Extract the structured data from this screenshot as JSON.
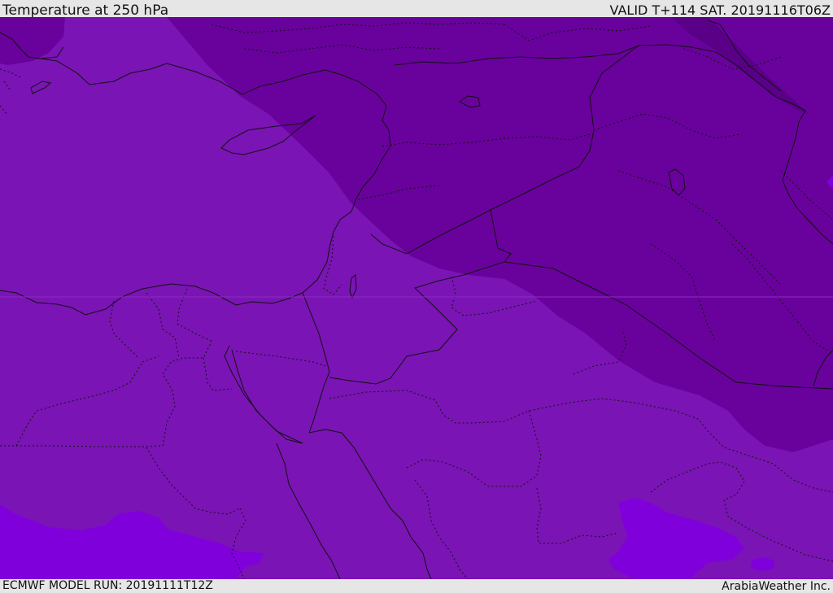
{
  "header": {
    "title": "Temperature at 250 hPa",
    "valid": "VALID T+114 SAT. 20191116T06Z"
  },
  "footer": {
    "model_run": "ECMWF MODEL RUN: 20191111T12Z",
    "credit": "ArabiaWeather Inc."
  },
  "map": {
    "field": "temperature_250hPa",
    "colors": {
      "base": "#7a14b4",
      "colder_band": "#69029c",
      "coldest_patch": "#5a0088",
      "warm_patch": "#8000dc",
      "border": "#111111"
    }
  }
}
